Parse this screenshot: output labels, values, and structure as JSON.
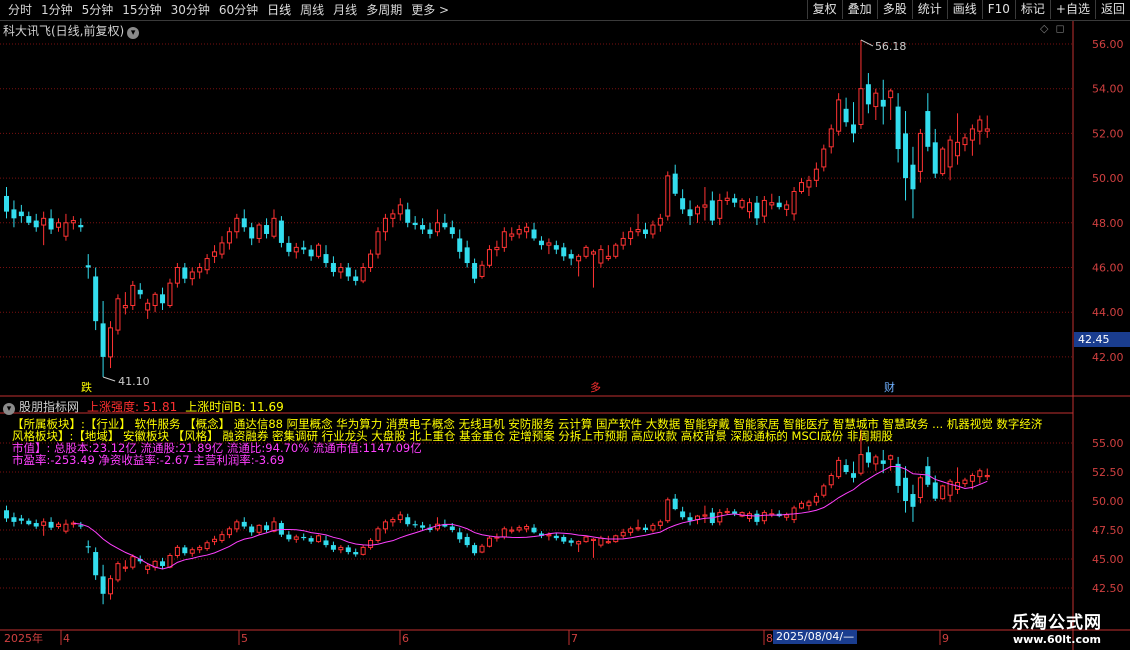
{
  "toolbar": {
    "periods": [
      "分时",
      "1分钟",
      "5分钟",
      "15分钟",
      "30分钟",
      "60分钟",
      "日线",
      "周线",
      "月线",
      "多周期",
      "更多 >"
    ],
    "buttons": [
      "复权",
      "叠加",
      "多股",
      "统计",
      "画线",
      "F10",
      "标记",
      "+自选",
      "返回"
    ]
  },
  "main_chart": {
    "title": "科大讯飞(日线,前复权)",
    "title_icon": "chevron-down-icon",
    "top_right_icons": [
      "diamond-icon",
      "expand-icon"
    ],
    "high_label": "56.18",
    "low_label": "41.10",
    "current_price": "42.45",
    "markers": [
      "跌",
      "多",
      "财"
    ]
  },
  "indicator": {
    "name": "股朋指标网",
    "name_icon": "chevron-down-icon",
    "field1_label": "上涨强度:",
    "field1_value": "51.81",
    "field2_label": "上涨时间B:",
    "field2_value": "11.69",
    "info_rows": [
      "【所属板块】:【行业】 软件服务 【概念】 通达信88 阿里概念 华为算力 消费电子概念 无线耳机 安防服务 云计算 国产软件 大数据 智能穿戴 智能家居 智能医疗 智慧城市 智慧政务 ... 机器视觉 数字经济",
      "  风格板块】:【地域】 安徽板块 【风格】 融资融券 密集调研 行业龙头 大盘股 北上重仓 基金重仓 定增预案 分拆上市预期 高应收款 高校背景 深股通标的 MSCI成份 非周期股",
      "    市值】:     总股本:23.12亿 流通股:21.89亿 流通比:94.70% 流通市值:1147.09亿",
      "                    市盈率:-253.49 净资收益率:-2.67 主营利润率:-3.69"
    ]
  },
  "bottom_axis": {
    "labels": [
      "2025年",
      "4",
      "5",
      "6",
      "7",
      "8",
      "9"
    ],
    "selected_date": "2025/08/04/—"
  },
  "watermark": {
    "line1": "乐淘公式网",
    "line2": "www.60lt.com"
  },
  "chart_data": {
    "type": "candlestick",
    "main_y_ticks": [
      "56.00",
      "54.00",
      "52.00",
      "50.00",
      "48.00",
      "46.00",
      "44.00",
      "42.00"
    ],
    "sub_y_ticks": [
      "55.00",
      "52.50",
      "50.00",
      "47.50",
      "45.00",
      "42.50"
    ],
    "colors": {
      "up": "#ff3333",
      "down": "#33ddee",
      "ma": "#ff40ff",
      "grid": "#7a1010",
      "axis": "#c03030"
    },
    "candles": [
      [
        49.2,
        49.6,
        48.2,
        48.5
      ],
      [
        48.6,
        49.0,
        47.8,
        48.2
      ],
      [
        48.5,
        48.8,
        48.0,
        48.3
      ],
      [
        48.3,
        48.5,
        47.9,
        48.0
      ],
      [
        48.1,
        48.4,
        47.6,
        47.8
      ],
      [
        47.9,
        48.5,
        47.0,
        48.2
      ],
      [
        48.2,
        48.6,
        47.5,
        47.7
      ],
      [
        47.8,
        48.2,
        47.6,
        48.0
      ],
      [
        47.4,
        48.4,
        47.2,
        48.0
      ],
      [
        48.0,
        48.3,
        47.7,
        48.1
      ],
      [
        47.9,
        48.2,
        47.6,
        47.8
      ],
      [
        46.1,
        46.6,
        45.5,
        46.0
      ],
      [
        45.6,
        46.0,
        43.2,
        43.6
      ],
      [
        43.5,
        44.5,
        41.1,
        42.0
      ],
      [
        42.0,
        43.6,
        41.5,
        43.3
      ],
      [
        43.2,
        44.8,
        43.0,
        44.6
      ],
      [
        44.2,
        44.9,
        43.9,
        44.3
      ],
      [
        44.3,
        45.4,
        44.1,
        45.2
      ],
      [
        45.0,
        45.3,
        44.6,
        44.8
      ],
      [
        44.1,
        44.6,
        43.7,
        44.4
      ],
      [
        44.3,
        44.9,
        44.0,
        44.8
      ],
      [
        44.8,
        45.1,
        44.1,
        44.4
      ],
      [
        44.3,
        45.5,
        44.2,
        45.3
      ],
      [
        45.3,
        46.2,
        45.1,
        46.0
      ],
      [
        46.0,
        46.2,
        45.3,
        45.5
      ],
      [
        45.5,
        46.0,
        45.2,
        45.8
      ],
      [
        45.8,
        46.2,
        45.5,
        46.0
      ],
      [
        45.9,
        46.6,
        45.7,
        46.4
      ],
      [
        46.5,
        47.0,
        46.2,
        46.7
      ],
      [
        46.6,
        47.4,
        46.4,
        47.1
      ],
      [
        47.1,
        47.8,
        46.8,
        47.6
      ],
      [
        47.6,
        48.4,
        47.3,
        48.2
      ],
      [
        48.2,
        48.6,
        47.6,
        47.8
      ],
      [
        47.8,
        48.0,
        47.0,
        47.3
      ],
      [
        47.3,
        48.0,
        47.1,
        47.9
      ],
      [
        47.9,
        48.2,
        47.3,
        47.5
      ],
      [
        47.4,
        48.6,
        47.3,
        48.2
      ],
      [
        48.1,
        48.3,
        46.9,
        47.1
      ],
      [
        47.1,
        47.4,
        46.5,
        46.7
      ],
      [
        46.7,
        47.1,
        46.4,
        46.9
      ],
      [
        46.9,
        47.2,
        46.6,
        46.8
      ],
      [
        46.8,
        47.0,
        46.3,
        46.5
      ],
      [
        46.5,
        47.1,
        46.4,
        47.0
      ],
      [
        46.6,
        47.0,
        46.0,
        46.2
      ],
      [
        46.2,
        46.5,
        45.6,
        45.8
      ],
      [
        45.8,
        46.2,
        45.5,
        46.0
      ],
      [
        46.0,
        46.2,
        45.4,
        45.6
      ],
      [
        45.6,
        45.9,
        45.2,
        45.4
      ],
      [
        45.4,
        46.2,
        45.3,
        46.0
      ],
      [
        46.0,
        46.8,
        45.8,
        46.6
      ],
      [
        46.6,
        47.8,
        46.4,
        47.6
      ],
      [
        47.6,
        48.4,
        47.2,
        48.2
      ],
      [
        48.2,
        48.6,
        47.8,
        48.4
      ],
      [
        48.4,
        49.1,
        48.1,
        48.8
      ],
      [
        48.6,
        48.9,
        47.8,
        48.0
      ],
      [
        48.0,
        48.3,
        47.7,
        47.9
      ],
      [
        47.9,
        48.2,
        47.5,
        47.7
      ],
      [
        47.7,
        48.0,
        47.3,
        47.5
      ],
      [
        47.6,
        48.6,
        47.4,
        48.0
      ],
      [
        48.0,
        48.4,
        47.7,
        47.8
      ],
      [
        47.8,
        48.1,
        47.3,
        47.5
      ],
      [
        47.3,
        47.7,
        46.4,
        46.7
      ],
      [
        46.9,
        47.2,
        46.0,
        46.2
      ],
      [
        46.2,
        46.4,
        45.3,
        45.5
      ],
      [
        45.6,
        46.3,
        45.5,
        46.1
      ],
      [
        46.1,
        47.0,
        46.0,
        46.8
      ],
      [
        46.8,
        47.2,
        46.5,
        46.9
      ],
      [
        46.9,
        47.8,
        46.7,
        47.6
      ],
      [
        47.4,
        47.8,
        47.2,
        47.5
      ],
      [
        47.5,
        47.9,
        47.3,
        47.7
      ],
      [
        47.6,
        48.0,
        47.3,
        47.8
      ],
      [
        47.7,
        48.0,
        47.2,
        47.3
      ],
      [
        47.2,
        47.4,
        46.8,
        47.0
      ],
      [
        47.0,
        47.3,
        46.6,
        47.1
      ],
      [
        47.0,
        47.2,
        46.6,
        46.8
      ],
      [
        46.9,
        47.1,
        46.3,
        46.5
      ],
      [
        46.6,
        46.8,
        46.1,
        46.4
      ],
      [
        46.3,
        46.6,
        45.6,
        46.5
      ],
      [
        46.5,
        47.0,
        46.4,
        46.9
      ],
      [
        46.6,
        46.8,
        45.1,
        46.7
      ],
      [
        46.2,
        47.0,
        46.0,
        46.8
      ],
      [
        46.4,
        47.0,
        46.3,
        46.5
      ],
      [
        46.5,
        47.1,
        46.4,
        47.0
      ],
      [
        47.0,
        47.6,
        46.8,
        47.3
      ],
      [
        47.3,
        47.8,
        47.0,
        47.6
      ],
      [
        47.6,
        48.4,
        47.4,
        47.7
      ],
      [
        47.7,
        48.0,
        47.3,
        47.5
      ],
      [
        47.5,
        48.1,
        47.3,
        47.9
      ],
      [
        47.9,
        48.4,
        47.6,
        48.2
      ],
      [
        48.3,
        50.3,
        48.1,
        50.1
      ],
      [
        50.2,
        50.6,
        49.2,
        49.3
      ],
      [
        49.1,
        49.5,
        48.4,
        48.6
      ],
      [
        48.6,
        49.0,
        47.9,
        48.3
      ],
      [
        48.4,
        48.8,
        48.0,
        48.7
      ],
      [
        48.7,
        49.6,
        48.1,
        48.8
      ],
      [
        49.0,
        49.4,
        47.9,
        48.1
      ],
      [
        48.2,
        49.3,
        47.9,
        49.0
      ],
      [
        49.0,
        49.4,
        48.8,
        49.1
      ],
      [
        49.1,
        49.3,
        48.7,
        48.9
      ],
      [
        48.7,
        49.1,
        48.6,
        49.0
      ],
      [
        48.5,
        49.1,
        48.2,
        48.9
      ],
      [
        48.9,
        49.2,
        47.9,
        48.2
      ],
      [
        48.3,
        49.2,
        48.0,
        49.0
      ],
      [
        48.8,
        49.3,
        48.6,
        48.9
      ],
      [
        48.9,
        49.2,
        48.6,
        48.7
      ],
      [
        48.6,
        49.0,
        48.3,
        48.8
      ],
      [
        48.4,
        49.6,
        48.1,
        49.4
      ],
      [
        49.4,
        50.0,
        49.3,
        49.8
      ],
      [
        49.6,
        50.1,
        49.2,
        49.9
      ],
      [
        49.9,
        50.7,
        49.6,
        50.4
      ],
      [
        50.5,
        51.5,
        50.3,
        51.3
      ],
      [
        51.4,
        52.4,
        51.1,
        52.2
      ],
      [
        52.1,
        53.8,
        51.9,
        53.5
      ],
      [
        53.1,
        53.6,
        52.3,
        52.5
      ],
      [
        52.4,
        53.4,
        51.6,
        52.0
      ],
      [
        52.4,
        56.18,
        52.2,
        54.0
      ],
      [
        54.2,
        54.7,
        52.9,
        53.3
      ],
      [
        53.2,
        54.0,
        52.6,
        53.8
      ],
      [
        53.5,
        54.4,
        52.4,
        53.2
      ],
      [
        53.6,
        54.0,
        52.6,
        53.9
      ],
      [
        53.2,
        53.8,
        50.7,
        51.3
      ],
      [
        52.0,
        53.0,
        49.0,
        50.0
      ],
      [
        50.6,
        51.4,
        48.2,
        49.5
      ],
      [
        50.3,
        52.2,
        49.8,
        52.0
      ],
      [
        53.0,
        53.8,
        51.2,
        51.4
      ],
      [
        51.6,
        52.2,
        50.0,
        50.2
      ],
      [
        50.2,
        51.4,
        50.1,
        51.3
      ],
      [
        50.5,
        51.9,
        49.9,
        51.7
      ],
      [
        51.0,
        52.9,
        50.6,
        51.6
      ],
      [
        51.5,
        52.0,
        51.2,
        51.8
      ],
      [
        51.7,
        52.4,
        51.0,
        52.2
      ],
      [
        52.1,
        52.8,
        51.5,
        52.6
      ],
      [
        52.1,
        52.8,
        51.8,
        52.2
      ]
    ]
  }
}
